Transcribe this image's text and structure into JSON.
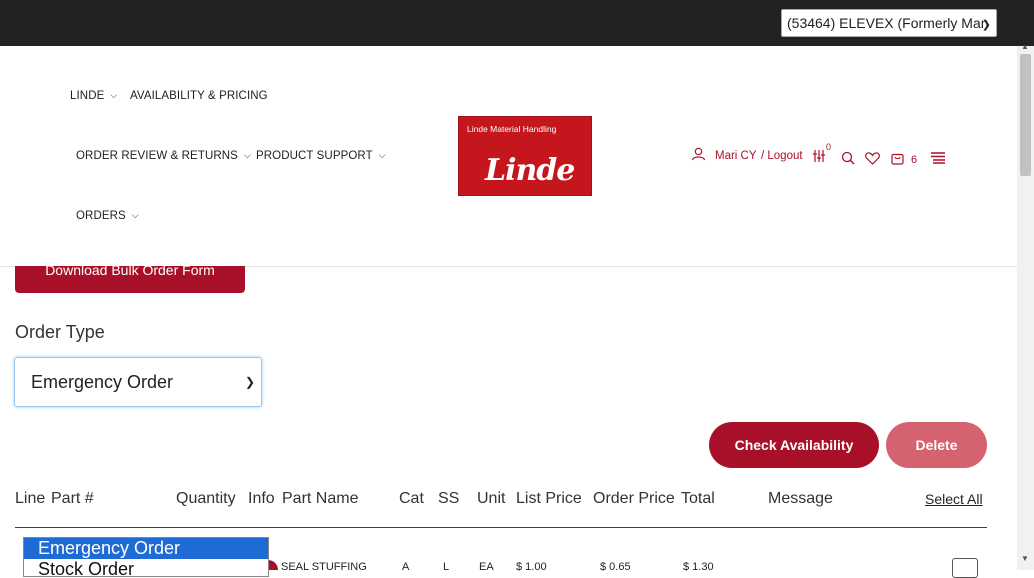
{
  "account_select": {
    "value": "(53464) ELEVEX (Formerly Man"
  },
  "nav": {
    "linde": "LINDE",
    "availability": "AVAILABILITY & PRICING",
    "order_review": "ORDER REVIEW & RETURNS",
    "product_support": "PRODUCT SUPPORT",
    "orders": "ORDERS"
  },
  "logo": {
    "small": "Linde Material Handling",
    "big": "Linde"
  },
  "utility": {
    "user": "Mari CY",
    "logout": "/ Logout",
    "compare_count": "0",
    "cart_count": "6"
  },
  "bulk_button": "Download Bulk Order Form",
  "order_type": {
    "label": "Order Type",
    "value": "Emergency Order"
  },
  "buttons": {
    "check": "Check Availability",
    "delete": "Delete"
  },
  "table": {
    "headers": [
      "Line",
      "Part #",
      "Quantity",
      "Info",
      "Part Name",
      "Cat",
      "SS",
      "Unit",
      "List Price",
      "Order Price",
      "Total",
      "Message"
    ],
    "select_all": "Select All",
    "row": {
      "part_name": "SEAL STUFFING",
      "cat": "A",
      "ss": "L",
      "unit": "EA",
      "list_price": "$ 1.00",
      "order_price": "$ 0.65",
      "total": "$ 1.30"
    }
  },
  "dropdown": {
    "options": [
      "Emergency Order",
      "Stock Order"
    ]
  },
  "colors": {
    "brand": "#a8102a",
    "logo_red": "#c4161c",
    "topbar": "#222222"
  }
}
